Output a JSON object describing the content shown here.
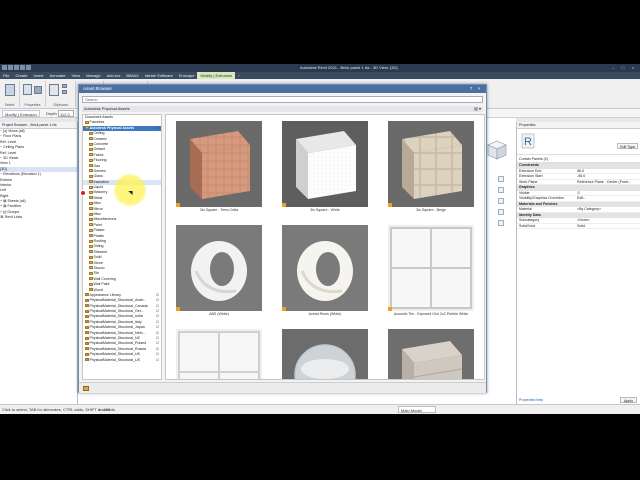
{
  "title_bar": {
    "title": "Autodesk Revit 2021 - Brick panel 1.rfa - 3D View: {3D}"
  },
  "ribbon": {
    "tabs": [
      "File",
      "Create",
      "Insert",
      "Annotate",
      "View",
      "Manage",
      "Add-Ins",
      "BIMAX",
      "Ideate Software",
      "Enscape",
      "Modify | Extrusion",
      "▫"
    ],
    "active_tab": "Modify | Extrusion",
    "groups": [
      "Select",
      "Properties",
      "Clipboard",
      "Geometry",
      "Modify",
      "Measure",
      "Create",
      "Mode",
      "Work Plane"
    ]
  },
  "options_bar": {
    "context": "Modify | Extrusion",
    "depth_label": "Depth",
    "depth_value": "112.0"
  },
  "project_browser": {
    "header": "Project Browser - Brick panel 1.rfa",
    "nodes": [
      "− [o] Views (all)",
      "   − Floor Plans",
      "         Ref. Level",
      "   − Ceiling Plans",
      "         Ref. Level",
      "   − 3D Views",
      "         View 1",
      "         {3D}",
      "   − Elevations (Elevation 1)",
      "         Exterior",
      "         Interior",
      "         Left",
      "         Right",
      "+ ▤ Sheets (all)",
      "+ ▤ Families",
      "+ [•] Groups",
      "   ⌘ Revit Links"
    ]
  },
  "asset_browser": {
    "title": "Asset Browser",
    "search_placeholder": "Search",
    "library": "Autodesk Physical Assets",
    "tree": [
      {
        "label": "Document Assets",
        "level": 0,
        "kind": "plain"
      },
      {
        "label": "Favorites",
        "level": 0,
        "kind": "folder"
      },
      {
        "label": "Autodesk Physical Assets",
        "level": 0,
        "kind": "selected"
      },
      {
        "label": "Ceiling",
        "level": 1,
        "kind": "folder"
      },
      {
        "label": "Ceramic",
        "level": 1,
        "kind": "folder"
      },
      {
        "label": "Concrete",
        "level": 1,
        "kind": "folder"
      },
      {
        "label": "Default",
        "level": 1,
        "kind": "folder"
      },
      {
        "label": "Fabric",
        "level": 1,
        "kind": "folder"
      },
      {
        "label": "Flooring",
        "level": 1,
        "kind": "folder"
      },
      {
        "label": "Gas",
        "level": 1,
        "kind": "folder"
      },
      {
        "label": "Generic",
        "level": 1,
        "kind": "folder"
      },
      {
        "label": "Glass",
        "level": 1,
        "kind": "folder"
      },
      {
        "label": "Insulation",
        "level": 1,
        "kind": "hover"
      },
      {
        "label": "Liquid",
        "level": 1,
        "kind": "folder"
      },
      {
        "label": "Masonry",
        "level": 1,
        "kind": "folder"
      },
      {
        "label": "Metal",
        "level": 1,
        "kind": "folder"
      },
      {
        "label": "Misc",
        "level": 1,
        "kind": "folder"
      },
      {
        "label": "Mirror",
        "level": 1,
        "kind": "folder"
      },
      {
        "label": "Misc",
        "level": 1,
        "kind": "folder"
      },
      {
        "label": "Miscellaneous",
        "level": 1,
        "kind": "folder"
      },
      {
        "label": "Paint",
        "level": 1,
        "kind": "folder"
      },
      {
        "label": "Plaster",
        "level": 1,
        "kind": "folder"
      },
      {
        "label": "Plastic",
        "level": 1,
        "kind": "folder"
      },
      {
        "label": "Roofing",
        "level": 1,
        "kind": "folder"
      },
      {
        "label": "Siding",
        "level": 1,
        "kind": "folder"
      },
      {
        "label": "Sitework",
        "level": 1,
        "kind": "folder"
      },
      {
        "label": "Soild",
        "level": 1,
        "kind": "folder"
      },
      {
        "label": "Stone",
        "level": 1,
        "kind": "folder"
      },
      {
        "label": "Stucco",
        "level": 1,
        "kind": "folder"
      },
      {
        "label": "Tile",
        "level": 1,
        "kind": "folder"
      },
      {
        "label": "Wall Covering",
        "level": 1,
        "kind": "folder"
      },
      {
        "label": "Wall Paint",
        "level": 1,
        "kind": "folder"
      },
      {
        "label": "Wood",
        "level": 1,
        "kind": "folder"
      },
      {
        "label": "Appearance Library",
        "level": 0,
        "kind": "phys"
      },
      {
        "label": "PhysicalMaterial_Structural_Austr...",
        "level": 0,
        "kind": "phys"
      },
      {
        "label": "PhysicalMaterial_Structural_Canada",
        "level": 0,
        "kind": "phys"
      },
      {
        "label": "PhysicalMaterial_Structural_Ger...",
        "level": 0,
        "kind": "phys"
      },
      {
        "label": "PhysicalMaterial_Structural_India",
        "level": 0,
        "kind": "phys"
      },
      {
        "label": "PhysicalMaterial_Structural_Italy",
        "level": 0,
        "kind": "phys"
      },
      {
        "label": "PhysicalMaterial_Structural_Japan",
        "level": 0,
        "kind": "phys"
      },
      {
        "label": "PhysicalMaterial_Structural_Neth...",
        "level": 0,
        "kind": "phys"
      },
      {
        "label": "PhysicalMaterial_Structural_NZ",
        "level": 0,
        "kind": "phys"
      },
      {
        "label": "PhysicalMaterial_Structural_Poland",
        "level": 0,
        "kind": "phys"
      },
      {
        "label": "PhysicalMaterial_Structural_Russia",
        "level": 0,
        "kind": "phys"
      },
      {
        "label": "PhysicalMaterial_Structural_UK",
        "level": 0,
        "kind": "phys"
      },
      {
        "label": "PhysicalMaterial_Structural_US",
        "level": 0,
        "kind": "phys"
      }
    ],
    "tiles": [
      {
        "caption": "3in Square - Terra Cotta",
        "kind": "terracotta"
      },
      {
        "caption": "3in Square - White",
        "kind": "white-cube"
      },
      {
        "caption": "3in Square - Beige",
        "kind": "beige-cube"
      },
      {
        "caption": "ABS (White)",
        "kind": "abs"
      },
      {
        "caption": "Acetal Resin (White)",
        "kind": "acetal"
      },
      {
        "caption": "Acoustic Tile - Exposed Grid 2x2 Pebble White",
        "kind": "acoustic"
      },
      {
        "caption": "",
        "kind": "panel"
      },
      {
        "caption": "",
        "kind": "glass"
      },
      {
        "caption": "",
        "kind": "stone-wall"
      }
    ]
  },
  "properties": {
    "header": "Properties",
    "type_icon_letter": "R",
    "edit_type": "Edit Type",
    "filter": "Curtain Panels (2)",
    "rows": [
      {
        "section": "Constraints"
      },
      {
        "k": "Extrusion End",
        "v": "56.0"
      },
      {
        "k": "Extrusion Start",
        "v": "-56.0"
      },
      {
        "k": "Work Plane",
        "v": "Reference Plane : Center (Front..."
      },
      {
        "section": "Graphics"
      },
      {
        "k": "Visible",
        "v": "☑"
      },
      {
        "k": "Visibility/Graphics Overrides",
        "v": "Edit..."
      },
      {
        "section": "Materials and Finishes"
      },
      {
        "k": "Material",
        "v": "<By Category>"
      },
      {
        "section": "Identity Data"
      },
      {
        "k": "Subcategory",
        "v": "<None>"
      },
      {
        "k": "Solid/Void",
        "v": "Solid"
      }
    ],
    "help": "Properties help",
    "apply": "Apply"
  },
  "status_bar": {
    "message": "Click to select, TAB for alternates, CTRL adds, SHIFT unselects.",
    "scale": "1 : 100",
    "model": "Main Model"
  },
  "colors": {
    "dialog_title": "#4a6fa0",
    "selection": "#3c78c3",
    "accent_folder": "#d8b35c"
  }
}
